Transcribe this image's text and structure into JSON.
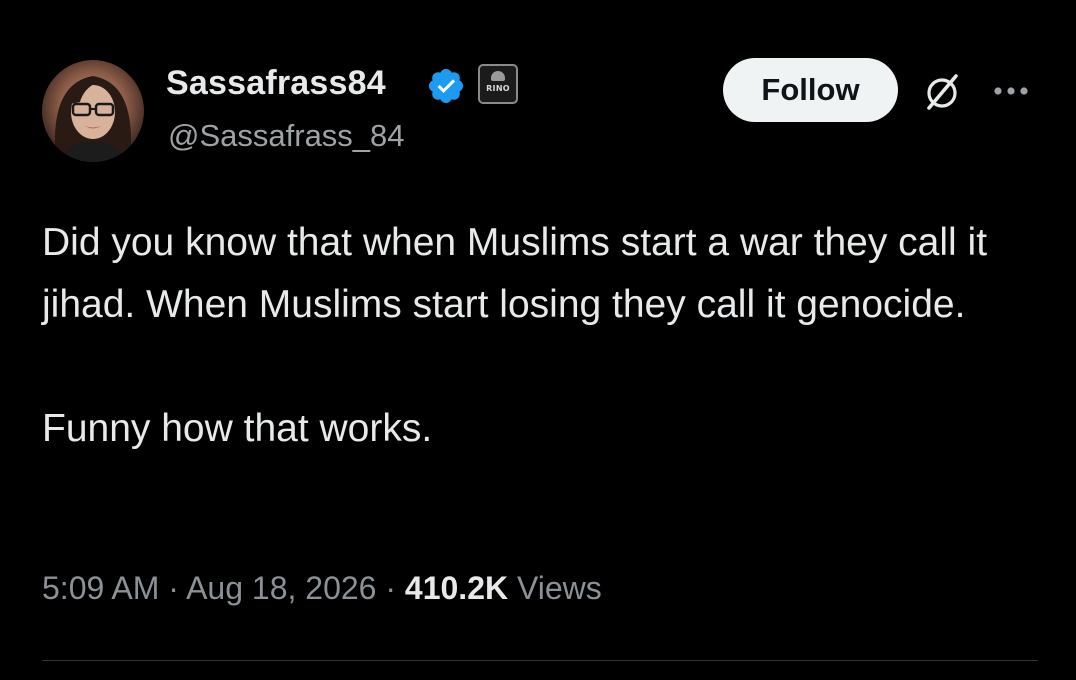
{
  "author": {
    "display_name": "Sassafrass84",
    "handle": "@Sassafrass_84",
    "verified": true,
    "affiliate_badge_text": "RINO"
  },
  "header": {
    "follow_label": "Follow",
    "icons": [
      "verified-badge-icon",
      "grok-icon",
      "more-options-icon"
    ]
  },
  "tweet": {
    "paragraphs": [
      "Did you know that when Muslims start a war they call it jihad. When Muslims start losing they call it genocide.",
      "Funny how that works."
    ],
    "time": "5:09 AM",
    "separator": "·",
    "date": "Aug 18, 2026",
    "views_count": "410.2K",
    "views_label": "Views"
  },
  "colors": {
    "background": "#000000",
    "text_primary": "#e7e9ea",
    "text_secondary": "#8b9196",
    "verified_blue": "#1d9bf0",
    "follow_button_bg": "#eff3f4",
    "divider": "#2f3336"
  }
}
